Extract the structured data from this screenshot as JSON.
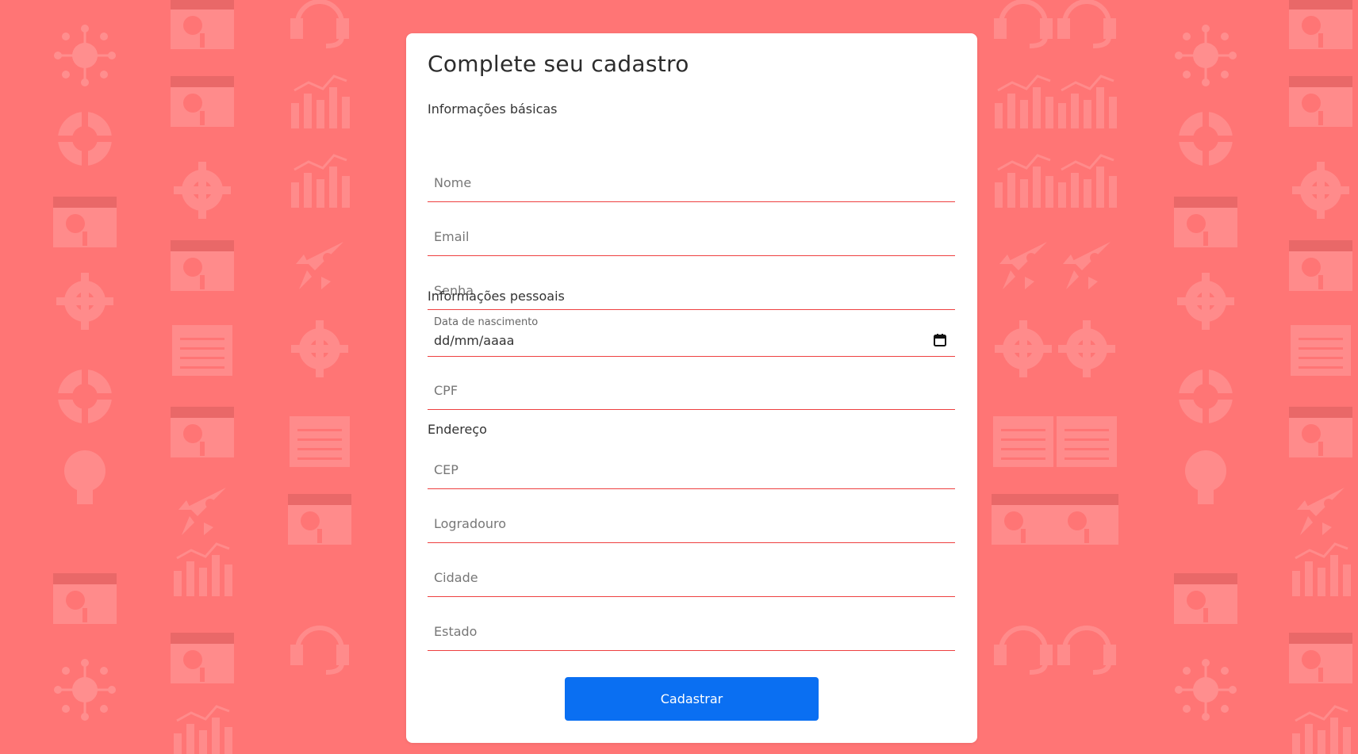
{
  "form": {
    "title": "Complete seu cadastro",
    "sections": {
      "basic": "Informações básicas",
      "personal": "Informações pessoais",
      "address": "Endereço"
    },
    "fields": {
      "nome": {
        "placeholder": "Nome",
        "value": ""
      },
      "email": {
        "placeholder": "Email",
        "value": ""
      },
      "senha": {
        "placeholder": "Senha",
        "value": ""
      },
      "nascimento": {
        "label": "Data de nascimento",
        "value": "dd/mm/aaaa"
      },
      "cpf": {
        "placeholder": "CPF",
        "value": ""
      },
      "cep": {
        "placeholder": "CEP",
        "value": ""
      },
      "logradouro": {
        "placeholder": "Logradouro",
        "value": ""
      },
      "cidade": {
        "placeholder": "Cidade",
        "value": ""
      },
      "estado": {
        "placeholder": "Estado",
        "value": ""
      }
    },
    "submit_label": "Cadastrar"
  },
  "colors": {
    "background": "#ff7575",
    "accent_line": "#ee4040",
    "button": "#0a6ff2"
  },
  "icons": {
    "calendar": "calendar-icon"
  }
}
